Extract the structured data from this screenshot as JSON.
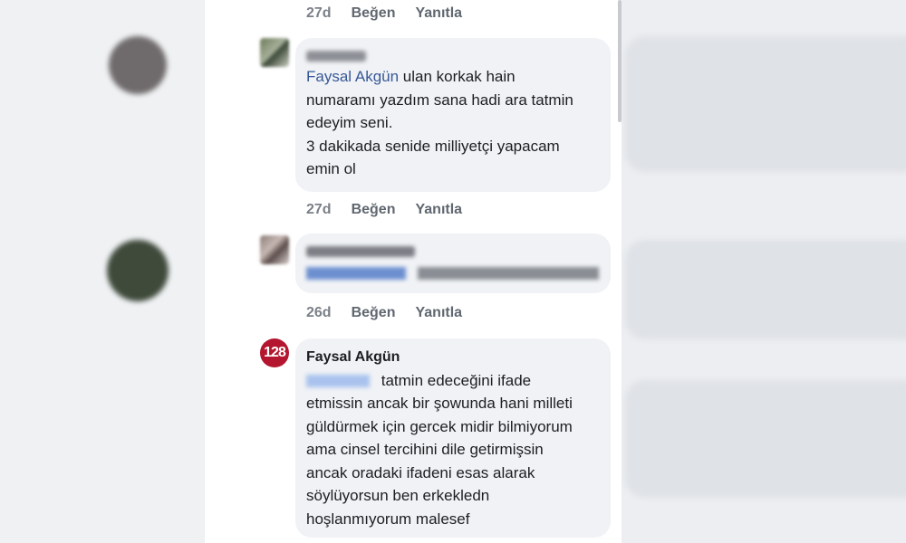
{
  "comments": [
    {
      "time": "27d",
      "like_label": "Beğen",
      "reply_label": "Yanıtla"
    },
    {
      "author": "",
      "mention": "Faysal Akgün",
      "text_lines": [
        "ulan korkak hain",
        "numaramı yazdım sana hadi ara tatmin",
        "edeyim seni.",
        "3 dakikada senide milliyetçi yapacam",
        "emin ol"
      ],
      "time": "27d",
      "like_label": "Beğen",
      "reply_label": "Yanıtla"
    },
    {
      "author": "",
      "text": "",
      "time": "26d",
      "like_label": "Beğen",
      "reply_label": "Yanıtla"
    },
    {
      "avatar_label": "128",
      "author": "Faysal Akgün",
      "text_lines": [
        "tatmin edeceğini ifade",
        "etmissin ancak  bir şowunda hani milleti",
        "güldürmek için gercek midir bilmiyorum",
        "ama cinsel tercihini dile getirmişsin",
        "ancak oradaki ifadeni esas alarak",
        "söylüyorsun  ben erkekledn",
        "hoşlanmıyorum malesef"
      ]
    }
  ],
  "colors": {
    "accent": "#385898",
    "bubble": "#f0f2f5",
    "avatar_badge": "#b3162e"
  }
}
